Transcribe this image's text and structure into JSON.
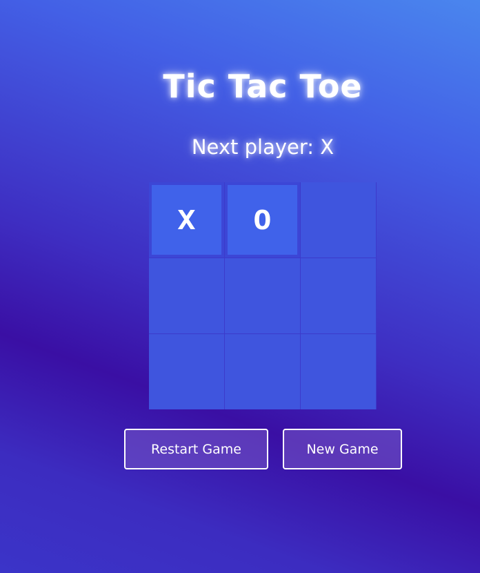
{
  "title": "Tic Tac Toe",
  "status": "Next player: X",
  "board": [
    "X",
    "O",
    "",
    "",
    "",
    "",
    "",
    "",
    ""
  ],
  "buttons": {
    "restart": "Restart Game",
    "new_game": "New Game"
  },
  "colors": {
    "background_top": "#4a86ee",
    "background_mid": "#3a0fa4",
    "cell": "#3f55de",
    "filled_cell": "#4062ea",
    "text": "#ffffff"
  }
}
